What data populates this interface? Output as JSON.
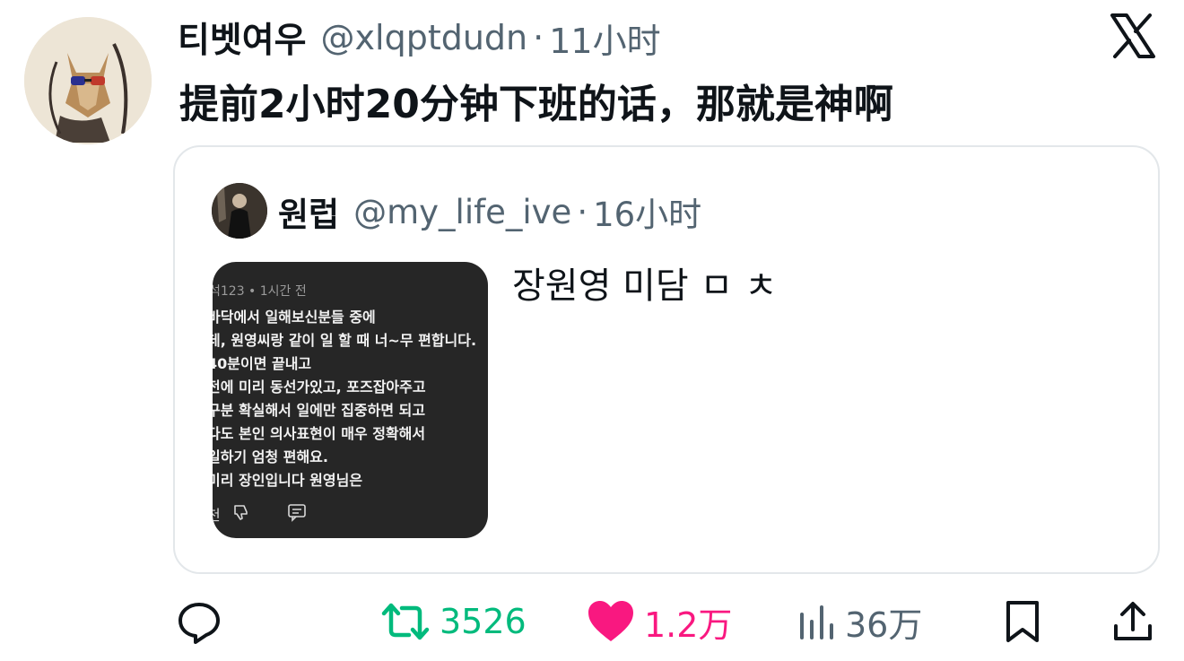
{
  "tweet": {
    "display_name": "티벳여우",
    "handle": "@xlqptdudn",
    "separator": "·",
    "time": "11小时",
    "text": "提前2小时20分钟下班的话，那就是神啊"
  },
  "quote": {
    "display_name": "원럽",
    "handle": "@my_life_ive",
    "separator": "·",
    "time": "16小时",
    "text": "장원영 미담 ㅁ ㅊ",
    "media": {
      "meta": "석123 • 1시간 전",
      "lines": [
        "바닥에서 일해보신분들 중에",
        "데, 원영씨랑 같이 일 할 때 너~무 편합니다.",
        "  40분이면 끝내고",
        "  전에 미리 동선가있고, 포즈잡아주고",
        "  구분 확실해서 일에만 집중하면 되고",
        "다도 본인 의사표현이 매우 정확해서",
        "일하기 엄청 편해요.",
        "미리 장인입니다 원영님은"
      ],
      "action_label": "천"
    }
  },
  "actions": {
    "reply_icon": "reply-icon",
    "retweet_count": "3526",
    "like_count": "1.2万",
    "views_count": "36万",
    "colors": {
      "retweet": "#00ba7c",
      "like": "#f91880",
      "muted": "#536471"
    }
  }
}
